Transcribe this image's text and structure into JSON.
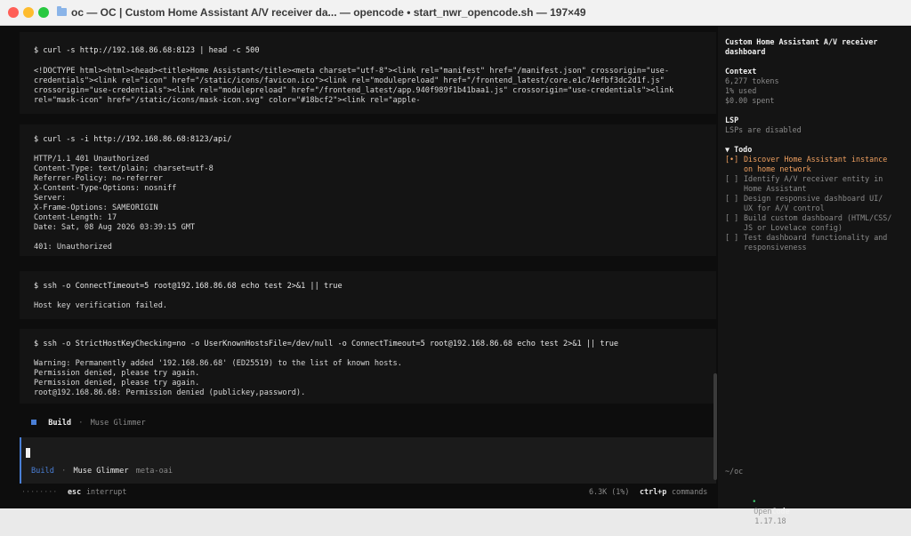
{
  "window": {
    "title": "oc — OC | Custom Home Assistant A/V receiver da... — opencode • start_nwr_opencode.sh — 197×49"
  },
  "blocks": [
    {
      "command": "$ curl -s http://192.168.86.68:8123 | head -c 500",
      "output": [
        "<!DOCTYPE html><html><head><title>Home Assistant</title><meta charset=\"utf-8\"><link rel=\"manifest\" href=\"/manifest.json\" crossorigin=\"use-",
        "credentials\"><link rel=\"icon\" href=\"/static/icons/favicon.ico\"><link rel=\"modulepreload\" href=\"/frontend_latest/core.e1c74efbf3dc2d1f.js\"",
        "crossorigin=\"use-credentials\"><link rel=\"modulepreload\" href=\"/frontend_latest/app.940f989f1b41baa1.js\" crossorigin=\"use-credentials\"><link",
        "rel=\"mask-icon\" href=\"/static/icons/mask-icon.svg\" color=\"#18bcf2\"><link rel=\"apple-"
      ]
    },
    {
      "command": "$ curl -s -i http://192.168.86.68:8123/api/",
      "output": [
        "HTTP/1.1 401 Unauthorized",
        "Content-Type: text/plain; charset=utf-8",
        "Referrer-Policy: no-referrer",
        "X-Content-Type-Options: nosniff",
        "Server:",
        "X-Frame-Options: SAMEORIGIN",
        "Content-Length: 17",
        "Date: Sat, 08 Aug 2026 03:39:15 GMT",
        "",
        "401: Unauthorized"
      ]
    },
    {
      "command": "$ ssh -o ConnectTimeout=5 root@192.168.86.68 echo test 2>&1 || true",
      "output": [
        "Host key verification failed."
      ]
    },
    {
      "command": "$ ssh -o StrictHostKeyChecking=no -o UserKnownHostsFile=/dev/null -o ConnectTimeout=5 root@192.168.86.68 echo test 2>&1 || true",
      "output": [
        "Warning: Permanently added '192.168.86.68' (ED25519) to the list of known hosts.",
        "Permission denied, please try again.",
        "Permission denied, please try again.",
        "root@192.168.86.68: Permission denied (publickey,password)."
      ]
    }
  ],
  "build_status": {
    "label": "Build",
    "separator": "·",
    "agent": "Muse Glimmer"
  },
  "prompt": {
    "mode": "Build",
    "separator": "·",
    "model": "Muse Glimmer",
    "provider": "meta-oai"
  },
  "footer": {
    "dots": "········",
    "esc_key": "esc",
    "esc_label": "interrupt",
    "usage": "6.3K (1%)",
    "cmd_key": "ctrl+p",
    "cmd_label": "commands"
  },
  "sidebar": {
    "title_lines": [
      "Custom Home Assistant A/V receiver",
      "dashboard"
    ],
    "context": {
      "heading": "Context",
      "lines": [
        "6,277 tokens",
        "1% used",
        "$0.00 spent"
      ]
    },
    "lsp": {
      "heading": "LSP",
      "lines": [
        "LSPs are disabled"
      ]
    },
    "todo": {
      "heading": "▼ Todo",
      "items": [
        {
          "mark": "[•]",
          "lines": [
            "Discover Home Assistant instance",
            "on home network"
          ],
          "active": true
        },
        {
          "mark": "[ ]",
          "lines": [
            "Identify A/V receiver entity in",
            "Home Assistant"
          ],
          "active": false
        },
        {
          "mark": "[ ]",
          "lines": [
            "Design responsive dashboard UI/",
            "UX for A/V control"
          ],
          "active": false
        },
        {
          "mark": "[ ]",
          "lines": [
            "Build custom dashboard (HTML/CSS/",
            "JS or Lovelace config)"
          ],
          "active": false
        },
        {
          "mark": "[ ]",
          "lines": [
            "Test dashboard functionality and",
            "responsiveness"
          ],
          "active": false
        }
      ]
    },
    "cwd": "~/oc",
    "app": {
      "dot": "•",
      "name_plain": "Open",
      "name_bold": "Code",
      "version": "1.17.18"
    }
  },
  "colors": {
    "accent_blue": "#4a7fd6",
    "todo_active": "#f0a060",
    "app_dot": "#3ec46d"
  }
}
